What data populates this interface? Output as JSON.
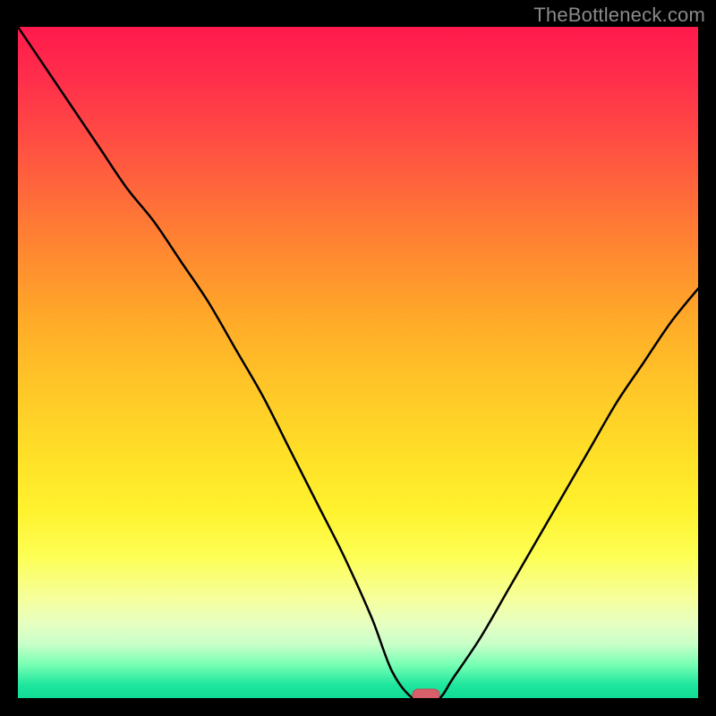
{
  "watermark": "TheBottleneck.com",
  "colors": {
    "page_bg": "#000000",
    "curve_stroke": "#000000",
    "marker_fill": "#d8606a",
    "gradient_top": "#ff1a4d",
    "gradient_bottom": "#0fdc95"
  },
  "chart_data": {
    "type": "line",
    "title": "",
    "xlabel": "",
    "ylabel": "",
    "xlim": [
      0,
      100
    ],
    "ylim": [
      0,
      100
    ],
    "grid": false,
    "legend": false,
    "note": "Bottleneck-style curve. Y is a mismatch/bottleneck percentage (0% = balanced, higher = worse). X is an unlabeled horizontal parameter. Values are estimated from pixel positions.",
    "x": [
      0,
      4,
      8,
      12,
      16,
      20,
      24,
      28,
      32,
      36,
      40,
      44,
      48,
      52,
      55,
      58,
      60,
      62,
      64,
      68,
      72,
      76,
      80,
      84,
      88,
      92,
      96,
      100
    ],
    "y": [
      100,
      94,
      88,
      82,
      76,
      71,
      65,
      59,
      52,
      45,
      37,
      29,
      21,
      12,
      4,
      0,
      0,
      0,
      3,
      9,
      16,
      23,
      30,
      37,
      44,
      50,
      56,
      61
    ],
    "optimum_marker": {
      "x": 60,
      "y": 0
    }
  }
}
